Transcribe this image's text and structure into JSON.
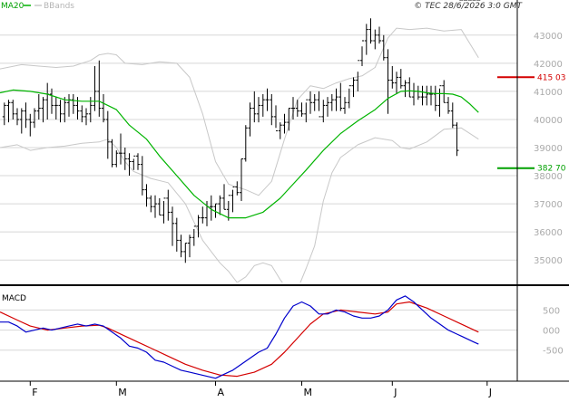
{
  "header": {
    "legend_ma20": "MA20",
    "legend_bbands": "BBands",
    "copyright": "© TEC 28/6/2026 3:0 GMT"
  },
  "colors": {
    "background": "#ffffff",
    "grid": "#d7d7d7",
    "price_bars": "#000000",
    "ma20": "#00b400",
    "bbands": "#c8c8c8",
    "macd": "#0000cc",
    "signal": "#d40000",
    "resistance": "#d40000",
    "support": "#00a000",
    "axis_text": "#aaaaaa"
  },
  "chart_data": [
    {
      "type": "candlestick",
      "title": "",
      "ylim": [
        34200,
        43800
      ],
      "y_ticks": [
        35000,
        36000,
        37000,
        38000,
        39000,
        40000,
        41000,
        42000,
        43000
      ],
      "y_tick_labels": [
        "35000",
        "36000",
        "37000",
        "38000",
        "39000",
        "40000",
        "41000",
        "42000",
        "43000"
      ],
      "x_month_labels": [
        {
          "label": "F",
          "day": 0
        },
        {
          "label": "M",
          "day": 20
        },
        {
          "label": "A",
          "day": 43
        },
        {
          "label": "M",
          "day": 63
        },
        {
          "label": "J",
          "day": 84
        },
        {
          "label": "J",
          "day": 106
        }
      ],
      "x_domain": [
        -7,
        113
      ],
      "levels": [
        {
          "name": "resistance",
          "value": 41503,
          "label": "415 03"
        },
        {
          "name": "support",
          "value": 38270,
          "label": "382 70"
        }
      ],
      "series": [
        {
          "name": "price",
          "days": [
            -6,
            -5,
            -4,
            -3,
            -2,
            -1,
            0,
            1,
            2,
            3,
            4,
            5,
            6,
            7,
            8,
            9,
            10,
            11,
            12,
            13,
            14,
            15,
            16,
            17,
            18,
            19,
            20,
            21,
            22,
            23,
            24,
            25,
            26,
            27,
            28,
            29,
            30,
            31,
            32,
            33,
            34,
            35,
            36,
            37,
            38,
            39,
            40,
            41,
            42,
            43,
            44,
            45,
            46,
            47,
            48,
            49,
            50,
            51,
            52,
            53,
            54,
            55,
            56,
            57,
            58,
            59,
            60,
            61,
            62,
            63,
            64,
            65,
            66,
            67,
            68,
            69,
            70,
            71,
            72,
            73,
            74,
            75,
            76,
            77,
            78,
            79,
            80,
            81,
            82,
            83,
            84,
            85,
            86,
            87,
            88,
            89,
            90,
            91,
            92,
            93,
            94,
            95,
            96,
            97,
            98,
            99,
            100,
            101,
            102,
            103,
            104
          ],
          "open": [
            40100,
            40500,
            40600,
            40200,
            40000,
            40300,
            40000,
            39900,
            40300,
            40400,
            40700,
            40900,
            40500,
            40500,
            40200,
            40600,
            40700,
            40500,
            40300,
            40100,
            40200,
            40500,
            41000,
            40400,
            40000,
            39200,
            38400,
            38800,
            38800,
            38600,
            38500,
            38700,
            38400,
            37500,
            37200,
            36900,
            37000,
            36600,
            37200,
            36700,
            36300,
            35700,
            35300,
            35600,
            35800,
            36200,
            36500,
            36500,
            36900,
            36900,
            37000,
            37200,
            36800,
            37300,
            37600,
            37400,
            38600,
            39700,
            40400,
            40200,
            40500,
            40700,
            40700,
            40100,
            39600,
            39800,
            39900,
            40400,
            40400,
            40300,
            40200,
            40700,
            40600,
            40700,
            40100,
            40500,
            40600,
            40700,
            40800,
            40400,
            40600,
            41200,
            41400,
            42100,
            42800,
            43200,
            42800,
            43000,
            42800,
            42200,
            41400,
            41300,
            41500,
            41200,
            41300,
            40800,
            41000,
            40800,
            40800,
            40900,
            40900,
            40500,
            41200,
            40600,
            40300,
            39800
          ],
          "high": [
            40600,
            40700,
            40700,
            40400,
            40400,
            40600,
            40200,
            40400,
            40900,
            40800,
            41300,
            41100,
            40800,
            40700,
            40800,
            40900,
            40900,
            40800,
            40500,
            40400,
            40800,
            41900,
            42100,
            40900,
            40300,
            39300,
            38900,
            39500,
            39000,
            38800,
            38600,
            38800,
            38700,
            37700,
            37300,
            37300,
            37200,
            37100,
            37500,
            36900,
            36500,
            35900,
            35600,
            35900,
            36100,
            36600,
            36900,
            37100,
            37300,
            37000,
            37300,
            37700,
            37100,
            37500,
            37800,
            38600,
            39800,
            40600,
            41000,
            40800,
            40900,
            41100,
            40900,
            40500,
            39900,
            40200,
            40400,
            40800,
            40700,
            40600,
            40600,
            41000,
            40900,
            41000,
            40700,
            40800,
            40900,
            41100,
            41300,
            40800,
            41100,
            41500,
            41700,
            42600,
            43400,
            43600,
            43200,
            43300,
            43000,
            42500,
            41900,
            41700,
            41800,
            41400,
            41500,
            41300,
            41200,
            41200,
            41200,
            41200,
            41200,
            41100,
            41400,
            40800,
            40600,
            39900
          ],
          "low": [
            39800,
            39900,
            40000,
            39800,
            39500,
            39700,
            39400,
            39700,
            40000,
            39900,
            40000,
            40200,
            40000,
            39900,
            39900,
            40100,
            40200,
            40000,
            39900,
            39800,
            39900,
            40300,
            40100,
            39900,
            38600,
            38300,
            38300,
            38400,
            38200,
            38000,
            38200,
            38200,
            37300,
            36900,
            36700,
            36500,
            36600,
            36300,
            36400,
            35500,
            35300,
            35100,
            34900,
            35100,
            35500,
            35800,
            36300,
            36200,
            36400,
            36500,
            36600,
            36800,
            36400,
            36700,
            37300,
            37100,
            38500,
            39400,
            39900,
            39900,
            40100,
            40300,
            39800,
            39700,
            39300,
            39500,
            39600,
            40000,
            40100,
            40100,
            39900,
            40200,
            40300,
            40300,
            39900,
            40100,
            40300,
            40300,
            40300,
            40200,
            40400,
            40800,
            41000,
            41900,
            42300,
            42700,
            42500,
            42700,
            42100,
            40200,
            41100,
            40900,
            41100,
            40800,
            40800,
            40500,
            40700,
            40500,
            40500,
            40500,
            40300,
            40100,
            40600,
            40200,
            39700,
            38700
          ],
          "close": [
            40500,
            40600,
            40200,
            40000,
            40300,
            40000,
            39900,
            40300,
            40400,
            40700,
            40900,
            40500,
            40500,
            40200,
            40600,
            40700,
            40500,
            40300,
            40100,
            40200,
            40500,
            41000,
            40400,
            40000,
            39200,
            38400,
            38800,
            38800,
            38600,
            38500,
            38700,
            38400,
            37500,
            37200,
            36900,
            37000,
            36600,
            37200,
            36700,
            36300,
            35700,
            35300,
            35600,
            35800,
            36200,
            36500,
            36500,
            36900,
            36900,
            37000,
            37200,
            36800,
            37300,
            37600,
            37400,
            38600,
            39700,
            40400,
            40200,
            40500,
            40700,
            40700,
            40100,
            39600,
            39800,
            39900,
            40400,
            40400,
            40300,
            40200,
            40700,
            40600,
            40700,
            40100,
            40500,
            40600,
            40700,
            40800,
            40400,
            40600,
            41200,
            41400,
            42100,
            42800,
            43200,
            42800,
            43000,
            42800,
            42200,
            41400,
            41300,
            41500,
            41200,
            41300,
            40800,
            41000,
            40800,
            40800,
            40900,
            40900,
            40500,
            41200,
            40600,
            40300,
            39800,
            38900
          ]
        },
        {
          "name": "MA20",
          "days": [
            -7,
            -4,
            0,
            4,
            8,
            12,
            16,
            20,
            23,
            27,
            30,
            34,
            38,
            42,
            46,
            50,
            54,
            58,
            61,
            64,
            68,
            72,
            76,
            80,
            83,
            86,
            88,
            90,
            92,
            94,
            96,
            98,
            100,
            102,
            104
          ],
          "values": [
            40950,
            41050,
            41000,
            40900,
            40700,
            40650,
            40650,
            40350,
            39800,
            39300,
            38700,
            38000,
            37300,
            36800,
            36500,
            36500,
            36700,
            37200,
            37700,
            38200,
            38900,
            39500,
            39950,
            40350,
            40750,
            41000,
            41020,
            41000,
            40950,
            40920,
            40920,
            40900,
            40800,
            40550,
            40250
          ]
        },
        {
          "name": "BBands upper",
          "days": [
            -7,
            -2,
            2,
            6,
            10,
            14,
            16,
            18,
            20,
            22,
            26,
            30,
            34,
            37,
            40,
            43,
            46,
            50,
            53,
            56,
            59,
            62,
            65,
            68,
            71,
            74,
            77,
            80,
            83,
            85,
            88,
            92,
            96,
            100,
            104
          ],
          "values": [
            41800,
            41950,
            41900,
            41850,
            41900,
            42100,
            42300,
            42350,
            42300,
            42000,
            41950,
            42050,
            42000,
            41500,
            40200,
            38500,
            37700,
            37500,
            37300,
            37800,
            39300,
            40700,
            41200,
            41100,
            41300,
            41450,
            41550,
            41850,
            42900,
            43250,
            43200,
            43250,
            43150,
            43200,
            42200
          ]
        },
        {
          "name": "BBands lower",
          "days": [
            -7,
            -3,
            0,
            4,
            8,
            12,
            16,
            18,
            20,
            22,
            24,
            28,
            32,
            36,
            38,
            40,
            42,
            44,
            46,
            48,
            50,
            52,
            54,
            56,
            58,
            60,
            62,
            64,
            66,
            68,
            70,
            72,
            76,
            80,
            84,
            86,
            88,
            92,
            96,
            100,
            104
          ],
          "values": [
            39000,
            39100,
            38900,
            39000,
            39050,
            39150,
            39200,
            39300,
            39000,
            38500,
            38150,
            37900,
            37750,
            37000,
            36350,
            35700,
            35300,
            34900,
            34600,
            34200,
            34400,
            34800,
            34900,
            34800,
            34300,
            33900,
            33950,
            34700,
            35500,
            37100,
            38100,
            38650,
            39100,
            39350,
            39250,
            39000,
            38950,
            39200,
            39650,
            39700,
            39300
          ]
        },
        {
          "name": "MACD",
          "days": [
            -7,
            -5,
            -3,
            -1,
            1,
            3,
            5,
            7,
            9,
            11,
            13,
            15,
            17,
            19,
            21,
            23,
            25,
            27,
            29,
            31,
            33,
            35,
            37,
            39,
            41,
            43,
            45,
            47,
            49,
            51,
            53,
            55,
            57,
            59,
            61,
            63,
            65,
            67,
            69,
            71,
            73,
            75,
            77,
            79,
            81,
            83,
            85,
            87,
            89,
            91,
            93,
            95,
            97,
            99,
            101,
            103,
            104
          ],
          "values": [
            200,
            200,
            100,
            -50,
            0,
            50,
            0,
            50,
            100,
            150,
            100,
            150,
            100,
            -50,
            -200,
            -400,
            -450,
            -550,
            -750,
            -800,
            -900,
            -1000,
            -1050,
            -1100,
            -1150,
            -1200,
            -1100,
            -1000,
            -850,
            -700,
            -550,
            -450,
            -100,
            300,
            600,
            700,
            600,
            400,
            400,
            500,
            450,
            350,
            300,
            300,
            350,
            500,
            750,
            850,
            700,
            500,
            300,
            150,
            0,
            -100,
            -200,
            -300,
            -350
          ]
        },
        {
          "name": "Signal",
          "days": [
            -7,
            -3,
            0,
            4,
            8,
            12,
            16,
            18,
            20,
            24,
            28,
            32,
            36,
            40,
            44,
            48,
            52,
            56,
            59,
            62,
            65,
            68,
            72,
            76,
            80,
            83,
            85,
            88,
            92,
            96,
            100,
            104
          ],
          "values": [
            450,
            250,
            100,
            0,
            50,
            100,
            120,
            50,
            -50,
            -250,
            -450,
            -650,
            -850,
            -1000,
            -1120,
            -1150,
            -1050,
            -850,
            -550,
            -200,
            150,
            400,
            500,
            450,
            400,
            450,
            650,
            700,
            550,
            350,
            150,
            -50
          ]
        }
      ]
    },
    {
      "type": "line",
      "title": "MACD",
      "ylim": [
        -1250,
        1050
      ],
      "y_ticks": [
        -500,
        0,
        500
      ],
      "y_tick_labels": [
        "-500",
        "000",
        "500"
      ]
    }
  ]
}
